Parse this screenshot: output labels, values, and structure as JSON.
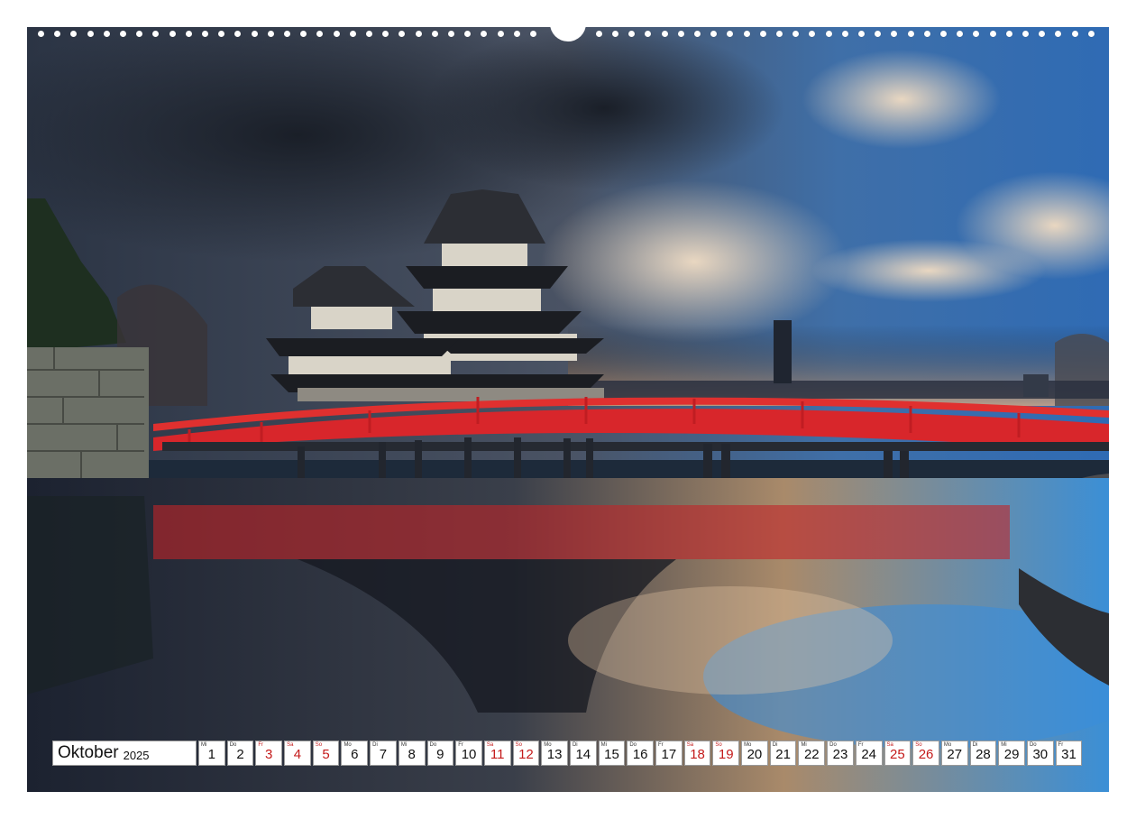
{
  "calendar": {
    "month": "Oktober",
    "year": "2025",
    "days": [
      {
        "wd": "Mi",
        "n": "1",
        "we": false
      },
      {
        "wd": "Do",
        "n": "2",
        "we": false
      },
      {
        "wd": "Fr",
        "n": "3",
        "we": true
      },
      {
        "wd": "Sa",
        "n": "4",
        "we": true
      },
      {
        "wd": "So",
        "n": "5",
        "we": true
      },
      {
        "wd": "Mo",
        "n": "6",
        "we": false
      },
      {
        "wd": "Di",
        "n": "7",
        "we": false
      },
      {
        "wd": "Mi",
        "n": "8",
        "we": false
      },
      {
        "wd": "Do",
        "n": "9",
        "we": false
      },
      {
        "wd": "Fr",
        "n": "10",
        "we": false
      },
      {
        "wd": "Sa",
        "n": "11",
        "we": true
      },
      {
        "wd": "So",
        "n": "12",
        "we": true
      },
      {
        "wd": "Mo",
        "n": "13",
        "we": false
      },
      {
        "wd": "Di",
        "n": "14",
        "we": false
      },
      {
        "wd": "Mi",
        "n": "15",
        "we": false
      },
      {
        "wd": "Do",
        "n": "16",
        "we": false
      },
      {
        "wd": "Fr",
        "n": "17",
        "we": false
      },
      {
        "wd": "Sa",
        "n": "18",
        "we": true
      },
      {
        "wd": "So",
        "n": "19",
        "we": true
      },
      {
        "wd": "Mo",
        "n": "20",
        "we": false
      },
      {
        "wd": "Di",
        "n": "21",
        "we": false
      },
      {
        "wd": "Mi",
        "n": "22",
        "we": false
      },
      {
        "wd": "Do",
        "n": "23",
        "we": false
      },
      {
        "wd": "Fr",
        "n": "24",
        "we": false
      },
      {
        "wd": "Sa",
        "n": "25",
        "we": true
      },
      {
        "wd": "So",
        "n": "26",
        "we": true
      },
      {
        "wd": "Mo",
        "n": "27",
        "we": false
      },
      {
        "wd": "Di",
        "n": "28",
        "we": false
      },
      {
        "wd": "Mi",
        "n": "29",
        "we": false
      },
      {
        "wd": "Do",
        "n": "30",
        "we": false
      },
      {
        "wd": "Fr",
        "n": "31",
        "we": false
      }
    ]
  },
  "colors": {
    "bridge": "#d8262b",
    "weekend": "#c41a1a"
  }
}
